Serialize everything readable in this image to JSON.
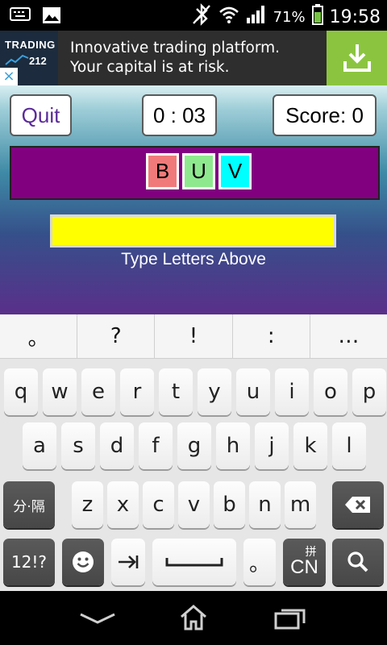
{
  "status": {
    "battery_percent": "71%",
    "time": "19:58"
  },
  "ad": {
    "logo_line1": "TRADING",
    "logo_line2": "212",
    "line1": "Innovative trading platform.",
    "line2": "Your capital is at risk.",
    "close_glyph": "×"
  },
  "game": {
    "quit_label": "Quit",
    "timer": "0 : 03",
    "score_label": "Score: 0",
    "tiles": [
      {
        "letter": "B",
        "color": "#f07a7a"
      },
      {
        "letter": "U",
        "color": "#8ee88e"
      },
      {
        "letter": "V",
        "color": "#00ffff"
      }
    ],
    "answer_color": "#ffff00",
    "hint": "Type Letters Above"
  },
  "keyboard": {
    "suggestions": [
      "。",
      "?",
      "!",
      ":",
      "…"
    ],
    "row1": [
      "q",
      "w",
      "e",
      "r",
      "t",
      "y",
      "u",
      "i",
      "o",
      "p"
    ],
    "row2": [
      "a",
      "s",
      "d",
      "f",
      "g",
      "h",
      "j",
      "k",
      "l"
    ],
    "row3": [
      "z",
      "x",
      "c",
      "v",
      "b",
      "n",
      "m"
    ],
    "separator_key": "分·隔",
    "symbols_key": "12!?",
    "period_key": "。",
    "lang_key_top": "拼",
    "lang_key": "CN"
  }
}
